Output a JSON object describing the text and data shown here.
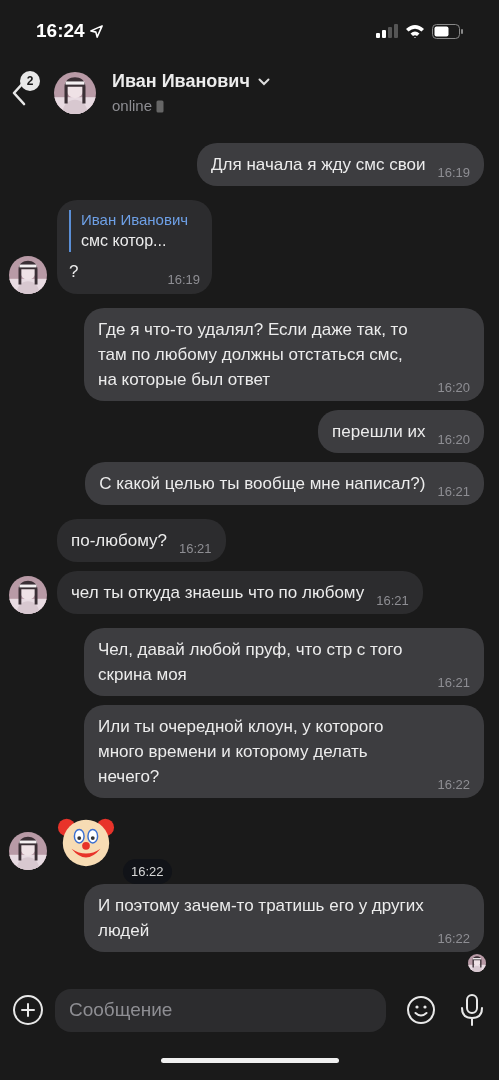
{
  "status_bar": {
    "time": "16:24"
  },
  "header": {
    "back_badge": "2",
    "name": "Иван Иванович",
    "status": "online"
  },
  "messages": [
    {
      "kind": "text",
      "outgoing": true,
      "text": "Для начала я жду смс свои",
      "time": "16:19"
    },
    {
      "kind": "reply",
      "outgoing": false,
      "reply_name": "Иван Иванович",
      "reply_text": "смс котор...",
      "text": "?",
      "time": "16:19",
      "avatar": true
    },
    {
      "kind": "text",
      "outgoing": true,
      "text": "Где я что-то удалял? Если даже так, то там по любому должны отстаться  смс, на которые был ответ",
      "time": "16:20"
    },
    {
      "kind": "text",
      "outgoing": true,
      "text": "перешли их",
      "time": "16:20"
    },
    {
      "kind": "text",
      "outgoing": true,
      "text": "С какой целью ты вообще мне написал?)",
      "time": "16:21"
    },
    {
      "kind": "text",
      "outgoing": false,
      "text": "по-любому?",
      "time": "16:21",
      "avatar": false
    },
    {
      "kind": "text",
      "outgoing": false,
      "text": "чел ты откуда знаешь что по любому",
      "time": "16:21",
      "avatar": true
    },
    {
      "kind": "text",
      "outgoing": true,
      "text": "Чел, давай любой пруф, что стр с того скрина моя",
      "time": "16:21"
    },
    {
      "kind": "text",
      "outgoing": true,
      "text": "Или ты очередной клоун, у которого много времени и которому делать нечего?",
      "time": "16:22"
    },
    {
      "kind": "emoji",
      "outgoing": false,
      "time": "16:22",
      "avatar": true
    },
    {
      "kind": "text",
      "outgoing": true,
      "text": "И поэтому зачем-то тратишь его у других людей",
      "time": "16:22",
      "read": true
    }
  ],
  "composer": {
    "placeholder": "Сообщение"
  }
}
